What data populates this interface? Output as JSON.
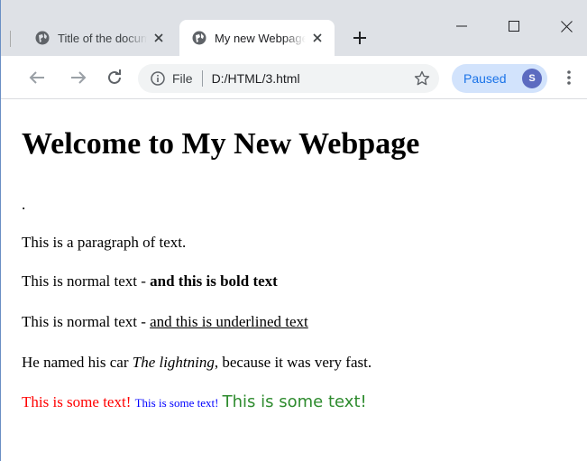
{
  "browser": {
    "tabs": [
      {
        "title": "Title of the document",
        "active": false,
        "icon": "globe-icon"
      },
      {
        "title": "My new Webpage",
        "active": true,
        "icon": "globe-icon"
      }
    ],
    "new_tab_icon": "plus-icon",
    "window_controls": [
      "minimize-icon",
      "maximize-icon",
      "close-icon"
    ],
    "toolbar": {
      "back_icon": "arrow-left-icon",
      "forward_icon": "arrow-right-icon",
      "reload_icon": "reload-icon",
      "site_info_icon": "info-icon",
      "scheme": "File",
      "url": "D:/HTML/3.html",
      "bookmark_icon": "star-icon",
      "profile_label": "Paused",
      "avatar_initial": "S",
      "menu_icon": "more-vert-icon"
    }
  },
  "page": {
    "heading": "Welcome to My New Webpage",
    "dot": ".",
    "paragraph": "This is a paragraph of text.",
    "bold_line": {
      "normal": "This is normal text - ",
      "bold": "and this is bold text"
    },
    "underline_line": {
      "normal": "This is normal text - ",
      "underlined": "and this is underlined text"
    },
    "italic_line": {
      "before": "He named his car ",
      "italic": "The lightning",
      "after": ", because it was very fast."
    },
    "colored_texts": [
      {
        "text": "This is some text!",
        "color": "#ff0000"
      },
      {
        "text": "This is some text!",
        "color": "#0000ff"
      },
      {
        "text": "This is some text!",
        "color": "#2e8b2e"
      }
    ]
  }
}
